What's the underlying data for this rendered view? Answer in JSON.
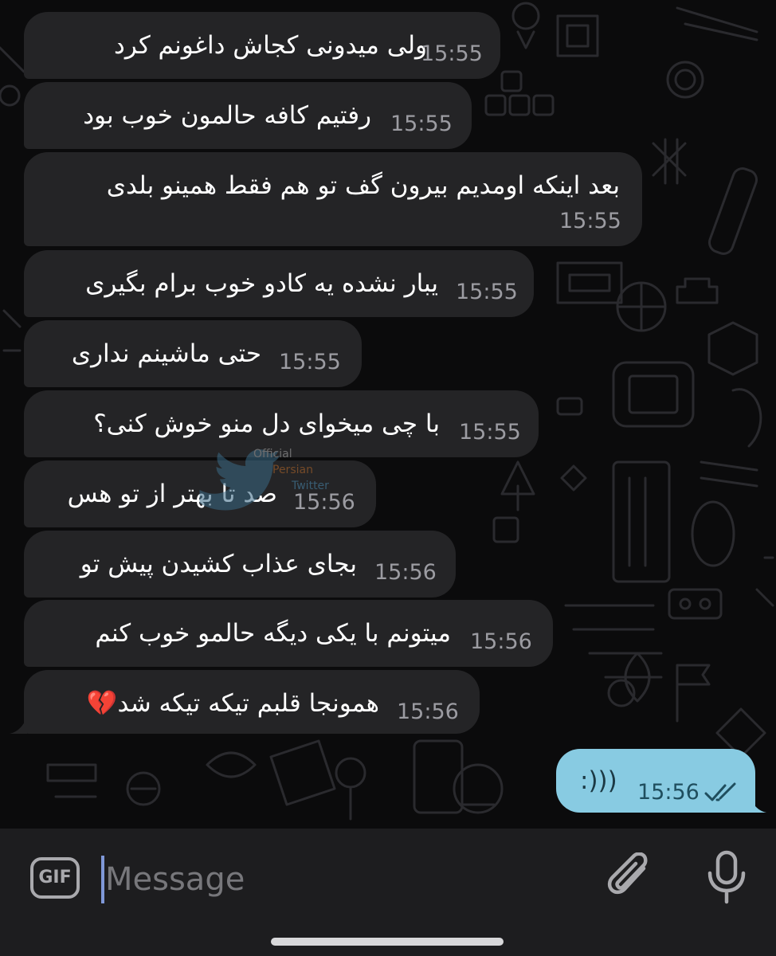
{
  "messages": [
    {
      "text": "ولی میدونی کجاش داغونم کرد",
      "time": "15:55"
    },
    {
      "text": "رفتیم کافه حالمون خوب بود",
      "time": "15:55"
    },
    {
      "text": "بعد اینکه اومدیم بیرون گف تو هم فقط همینو بلدی",
      "time": "15:55"
    },
    {
      "text": "یبار نشده یه کادو خوب برام بگیری",
      "time": "15:55"
    },
    {
      "text": "حتی ماشینم نداری",
      "time": "15:55"
    },
    {
      "text": "با چی میخوای دل منو خوش کنی؟",
      "time": "15:55"
    },
    {
      "text": "صد تا بهتر از تو هس",
      "time": "15:56"
    },
    {
      "text": "بجای عذاب کشیدن پیش تو",
      "time": "15:56"
    },
    {
      "text": "میتونم با یکی دیگه حالمو خوب کنم",
      "time": "15:56"
    },
    {
      "text": "همونجا قلبم تیکه تیکه شد💔",
      "time": "15:56"
    }
  ],
  "outgoing": {
    "text": ":)))",
    "time": "15:56",
    "status_icon": "double-check-icon"
  },
  "watermark": {
    "line1": "Official",
    "line2": "Persian",
    "line3": "Twitter"
  },
  "composer": {
    "gif_label": "GIF",
    "placeholder": "Message"
  },
  "colors": {
    "background": "#0b0b0c",
    "incoming_bubble": "#242426",
    "outgoing_bubble": "#88cbe2",
    "composer": "#1d1d1f"
  }
}
